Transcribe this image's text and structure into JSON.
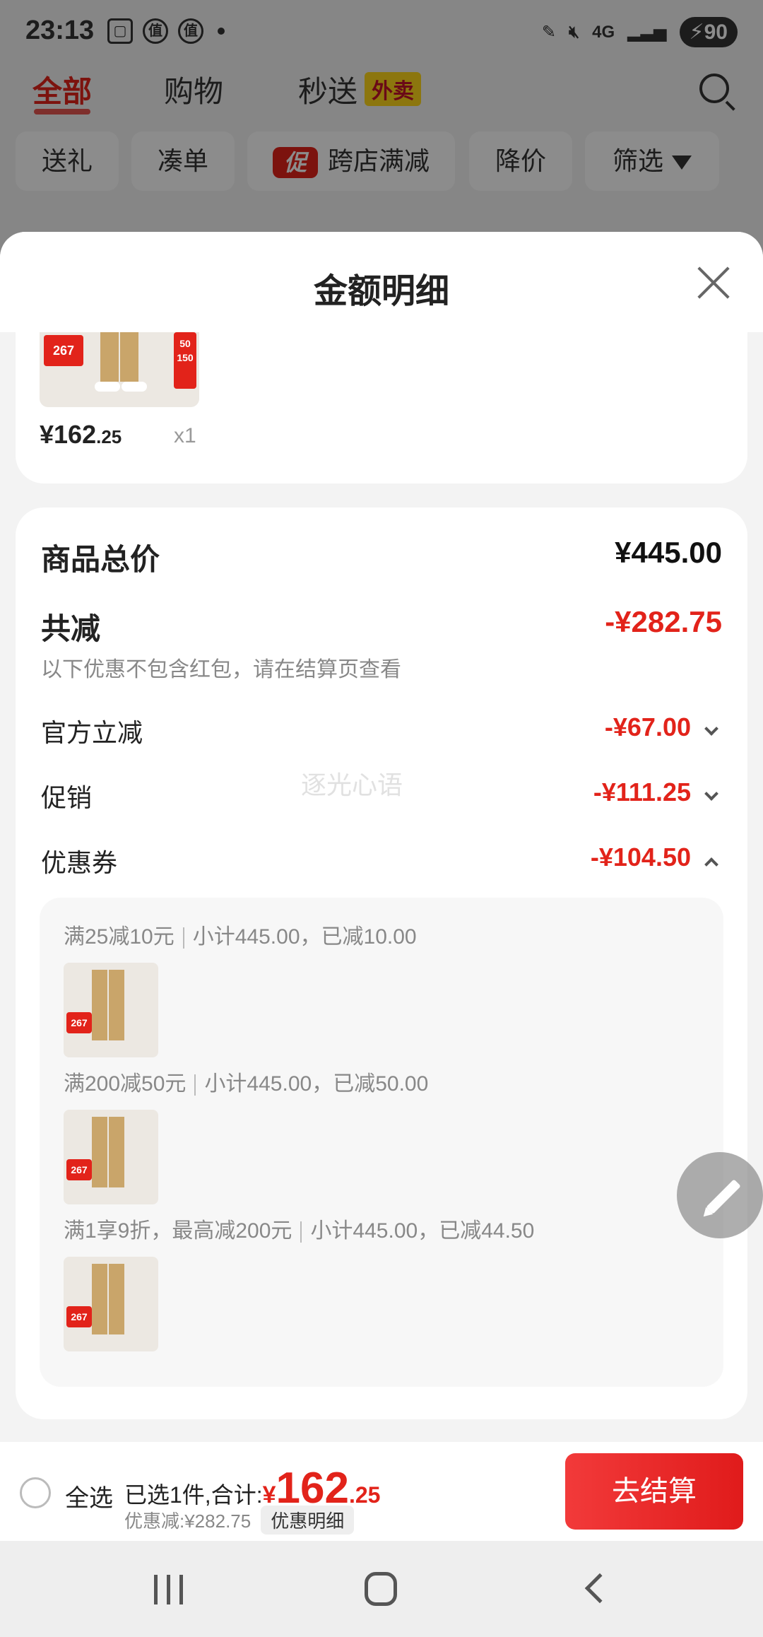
{
  "status_bar": {
    "time": "23:13",
    "left_icons": [
      "screenshot-icon",
      "zhi-app-icon",
      "zhi-app-icon"
    ],
    "left_icon_glyph": "值",
    "network": "4G",
    "battery": "90"
  },
  "tabs": [
    {
      "label": "全部",
      "active": true
    },
    {
      "label": "购物",
      "active": false
    },
    {
      "label": "秒送",
      "active": false
    }
  ],
  "takeout_badge": "外卖",
  "chips": [
    "送礼",
    "凑单",
    "跨店满减",
    "降价",
    "筛选"
  ],
  "promo_mark": "促",
  "sheet": {
    "title": "金额明细",
    "product": {
      "price_main": "¥162",
      "price_cents": ".25",
      "quantity": "x1"
    },
    "total_label": "商品总价",
    "total_value": "¥445.00",
    "discount_label": "共减",
    "discount_value": "-¥282.75",
    "discount_note": "以下优惠不包含红包，请在结算页查看",
    "items": [
      {
        "label": "官方立减",
        "value": "-¥67.00",
        "expanded": false
      },
      {
        "label": "促销",
        "value": "-¥111.25",
        "expanded": false
      },
      {
        "label": "优惠券",
        "value": "-¥104.50",
        "expanded": true
      }
    ],
    "coupons": [
      {
        "rule": "满25减10元",
        "detail": "小计445.00，已减10.00"
      },
      {
        "rule": "满200减50元",
        "detail": "小计445.00，已减50.00"
      },
      {
        "rule": "满1享9折，最高减200元",
        "detail": "小计445.00，已减44.50"
      }
    ],
    "thumb_tags": {
      "price": "267",
      "tag_a": "50",
      "tag_b": "150"
    }
  },
  "watermark": "逐光心语",
  "checkout": {
    "select_all": "全选",
    "selected_text": "已选1件,合计:",
    "yen": "¥",
    "total_main": "162",
    "total_cents": ".25",
    "discount_text": "优惠减:¥282.75",
    "detail_button": "优惠明细",
    "checkout_button": "去结算"
  },
  "colors": {
    "accent": "#e2231a",
    "takeout_badge_bg": "#ffd71a"
  }
}
